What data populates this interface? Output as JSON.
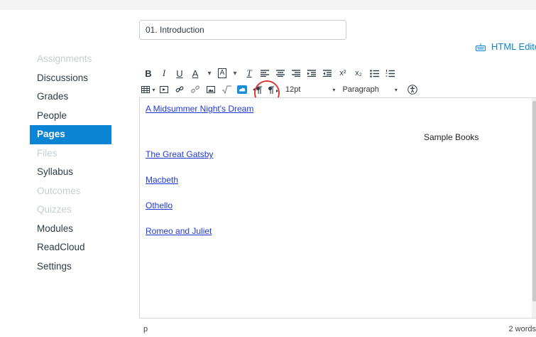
{
  "page": {
    "title_value": "01. Introduction",
    "html_editor_label": "HTML Edito"
  },
  "sidebar": {
    "items": [
      {
        "label": "Assignments",
        "state": "disabled"
      },
      {
        "label": "Discussions",
        "state": "normal"
      },
      {
        "label": "Grades",
        "state": "normal"
      },
      {
        "label": "People",
        "state": "normal"
      },
      {
        "label": "Pages",
        "state": "active"
      },
      {
        "label": "Files",
        "state": "disabled"
      },
      {
        "label": "Syllabus",
        "state": "normal"
      },
      {
        "label": "Outcomes",
        "state": "disabled"
      },
      {
        "label": "Quizzes",
        "state": "disabled"
      },
      {
        "label": "Modules",
        "state": "normal"
      },
      {
        "label": "ReadCloud",
        "state": "normal"
      },
      {
        "label": "Settings",
        "state": "normal"
      }
    ]
  },
  "toolbar": {
    "bold": "B",
    "italic": "I",
    "underline": "U",
    "font_color": "A",
    "background_color": "A",
    "clear_format": "T",
    "superscript": "x²",
    "subscript": "x₂",
    "font_size": "12pt",
    "format": "Paragraph"
  },
  "editor": {
    "links": [
      "A Midsummer Night's Dream",
      "The Great Gatsby",
      "Macbeth",
      "Othello",
      "Romeo and Juliet"
    ],
    "centered_text": "Sample Books"
  },
  "status": {
    "path": "p",
    "word_count": "2 words"
  },
  "colors": {
    "accent": "#0a84d3",
    "link": "#2139d0",
    "highlight_circle": "#d83a3a"
  }
}
